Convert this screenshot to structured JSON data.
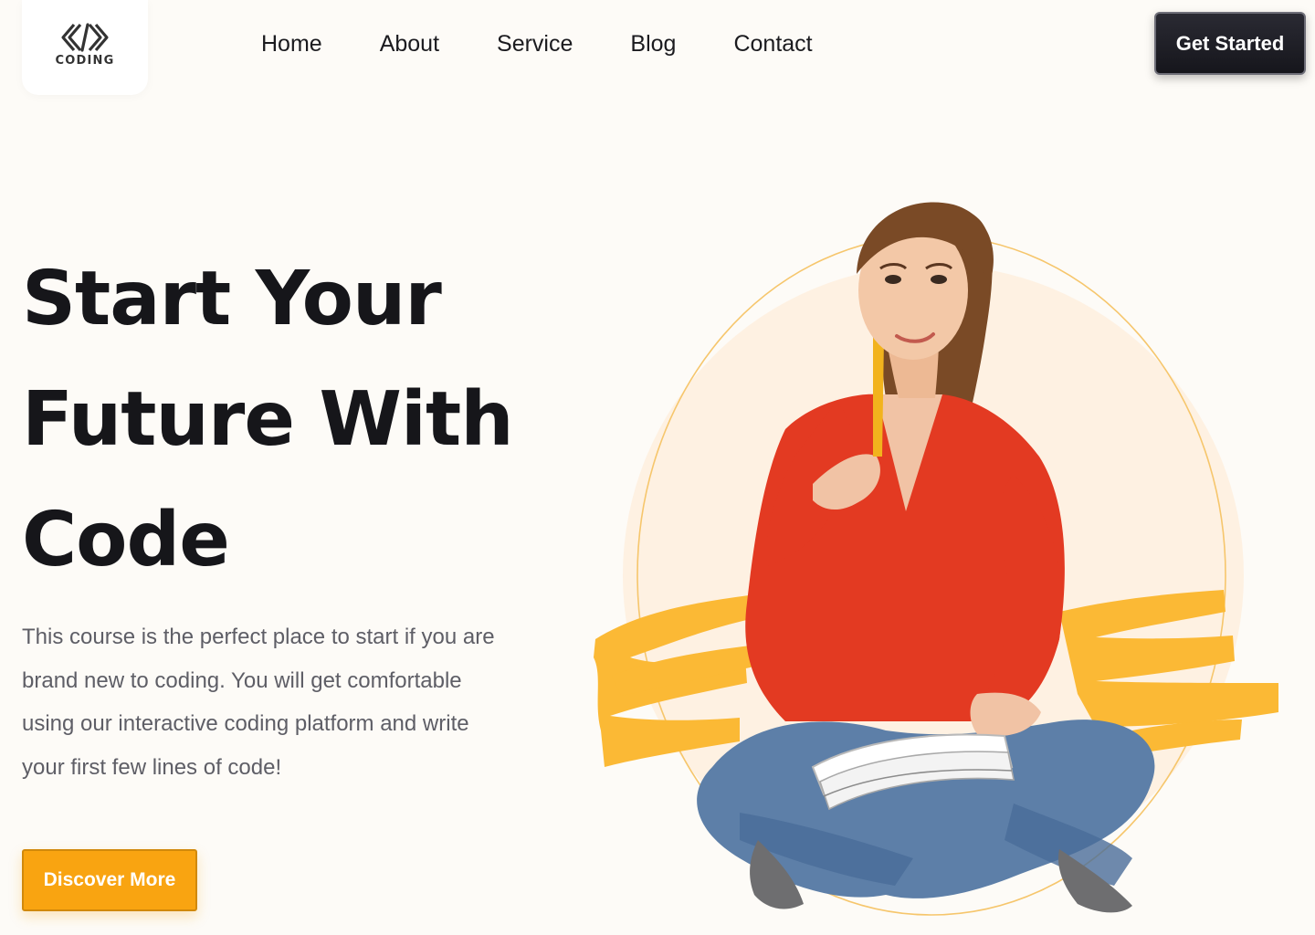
{
  "header": {
    "logo_text": "CODING",
    "nav": [
      {
        "label": "Home"
      },
      {
        "label": "About"
      },
      {
        "label": "Service"
      },
      {
        "label": "Blog"
      },
      {
        "label": "Contact"
      }
    ],
    "cta_label": "Get Started"
  },
  "hero": {
    "title_lines": [
      "Start Your",
      "Future With",
      "Code"
    ],
    "description": "This course is the perfect place to start if you are brand new to coding. You will get comfortable using our interactive coding platform and write your first few lines of code!",
    "button_label": "Discover More"
  },
  "colors": {
    "accent": "#f9a411",
    "dark": "#16161a",
    "background": "#fdfbf7",
    "body_text": "#5e5e66",
    "circle_fill": "#fdeedb",
    "brush": "#fbb935"
  },
  "icons": {
    "logo": "code-brackets-icon"
  }
}
